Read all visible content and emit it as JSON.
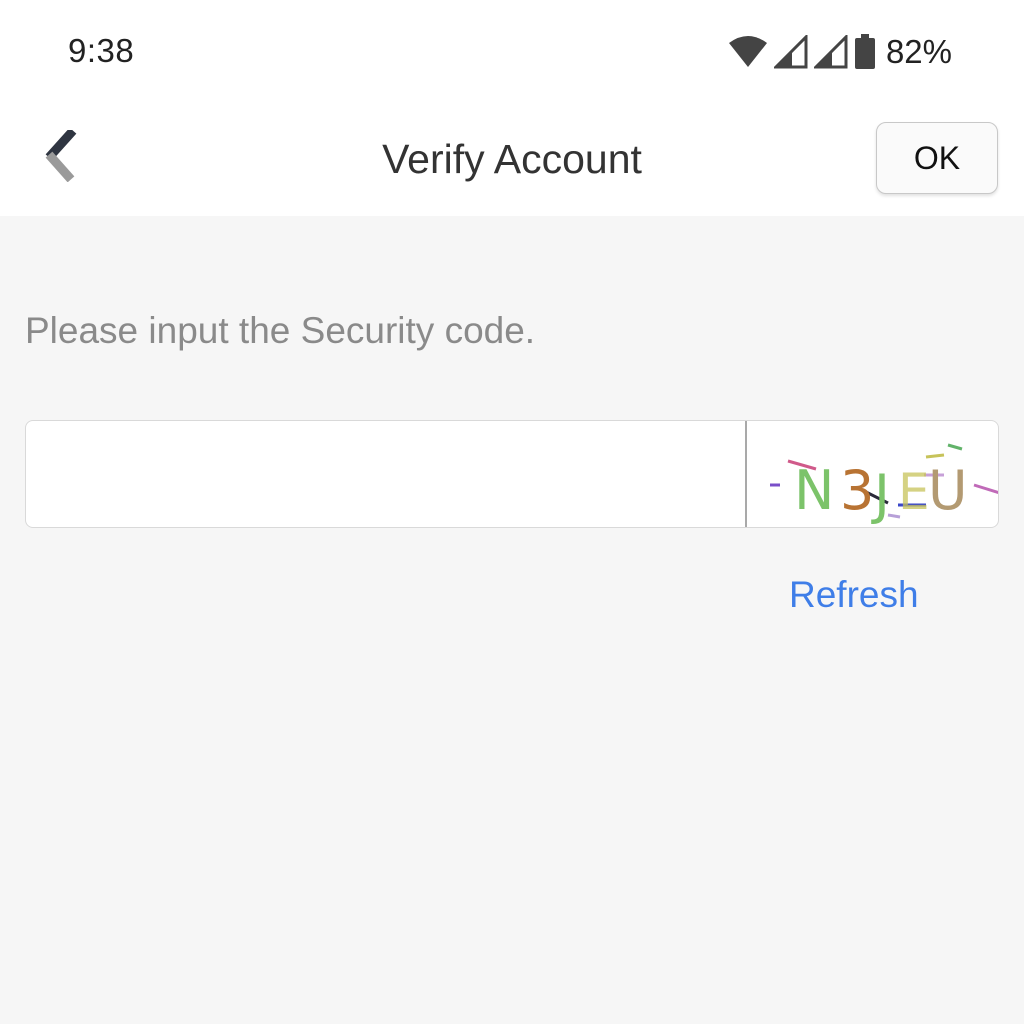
{
  "status_bar": {
    "time": "9:38",
    "battery": "82%",
    "icons": [
      "wifi-icon",
      "signal-icon",
      "signal-icon",
      "battery-icon"
    ]
  },
  "toolbar": {
    "back_icon": "back-arrow-icon",
    "title": "Verify Account",
    "ok_label": "OK"
  },
  "form": {
    "instruction": "Please input the Security code.",
    "code_value": "",
    "captcha_text": "N3JEU",
    "refresh_label": "Refresh"
  },
  "colors": {
    "link": "#3f7ee8",
    "background": "#f6f6f6",
    "captcha_green": "#7cc36a",
    "captcha_brown": "#b87333",
    "captcha_tan": "#b39a72"
  }
}
